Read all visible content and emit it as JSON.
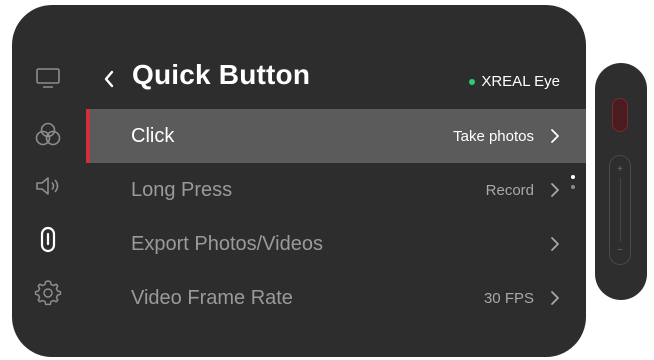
{
  "header": {
    "title": "Quick Button",
    "status_label": "XREAL Eye",
    "status_color": "#2ecc71"
  },
  "sidebar": {
    "items": [
      {
        "icon": "display-icon",
        "selected": false
      },
      {
        "icon": "color-circles-icon",
        "selected": false
      },
      {
        "icon": "volume-icon",
        "selected": false
      },
      {
        "icon": "paperclip-icon",
        "selected": true
      },
      {
        "icon": "gear-icon",
        "selected": false
      }
    ]
  },
  "menu": {
    "rows": [
      {
        "label": "Click",
        "value": "Take photos",
        "selected": true
      },
      {
        "label": "Long Press",
        "value": "Record",
        "selected": false
      },
      {
        "label": "Export Photos/Videos",
        "value": "",
        "selected": false
      },
      {
        "label": "Video Frame Rate",
        "value": "30 FPS",
        "selected": false
      }
    ]
  },
  "remote": {
    "plus_label": "+",
    "minus_label": "−"
  },
  "colors": {
    "accent_red": "#d12f3a",
    "panel_bg": "#2d2d2d",
    "selected_row_bg": "#5b5b5b"
  }
}
